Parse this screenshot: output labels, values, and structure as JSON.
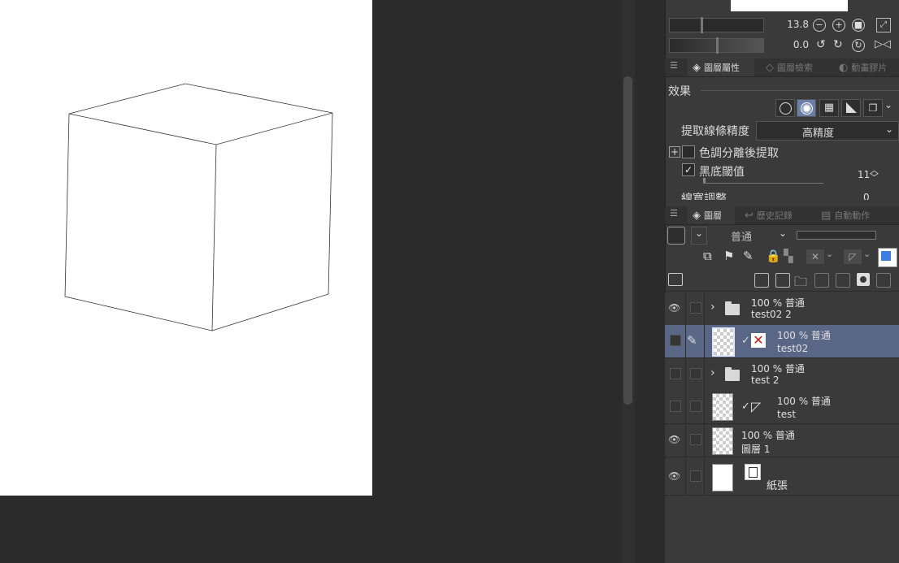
{
  "navigator": {
    "zoom_value": "13.8",
    "rotate_value": "0.0"
  },
  "property_tabs": {
    "tab1": "圖層屬性",
    "tab2": "圖層檢索",
    "tab3": "動畫膠片"
  },
  "properties": {
    "effect_label": "效果",
    "line_precision_label": "提取線條精度",
    "line_precision_value": "高精度",
    "tone_extract_label": "色調分離後提取",
    "black_threshold_label": "黑底閾值",
    "black_threshold_value": "11",
    "line_width_label": "線寬調整",
    "line_width_value": "0"
  },
  "layer_tabs": {
    "tab1": "圖層",
    "tab2": "歷史記錄",
    "tab3": "自動動作"
  },
  "layer_toolbar": {
    "blend_mode": "普通"
  },
  "layers": [
    {
      "mode": "100 % 普通",
      "name": "test02 2"
    },
    {
      "mode": "100 % 普通",
      "name": "test02"
    },
    {
      "mode": "100 % 普通",
      "name": "test 2"
    },
    {
      "mode": "100 % 普通",
      "name": "test"
    },
    {
      "mode": "100 % 普通",
      "name": "圖層 1"
    },
    {
      "mode": "",
      "name": "紙張"
    }
  ]
}
